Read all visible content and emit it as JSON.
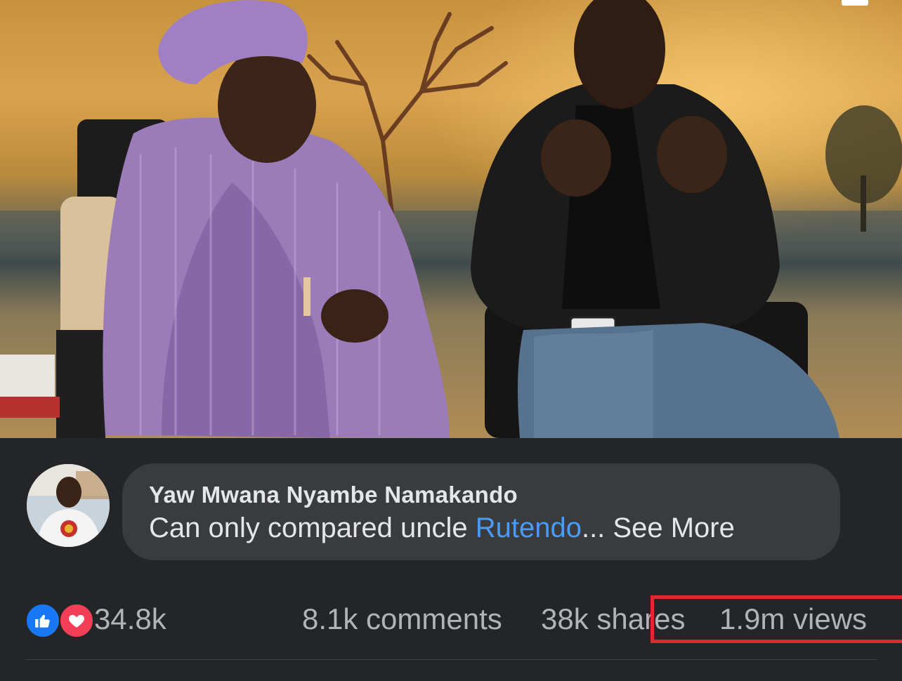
{
  "video": {
    "description_icon": "video-frame"
  },
  "comment": {
    "author": "Yaw Mwana Nyambe Namakando",
    "text_prefix": "Can only compared uncle ",
    "mention": "Rutendo",
    "ellipsis": "...",
    "see_more": " See More"
  },
  "stats": {
    "reactions": {
      "count": "34.8k",
      "icons": [
        "like-icon",
        "love-icon"
      ]
    },
    "comments": "8.1k comments",
    "shares": "38k shares",
    "views": "1.9m views"
  },
  "colors": {
    "background": "#242526",
    "bubble": "#3a3b3c",
    "mention": "#4a9bf5",
    "highlight": "#e0282f",
    "like": "#1877f2",
    "love": "#f33e58"
  }
}
